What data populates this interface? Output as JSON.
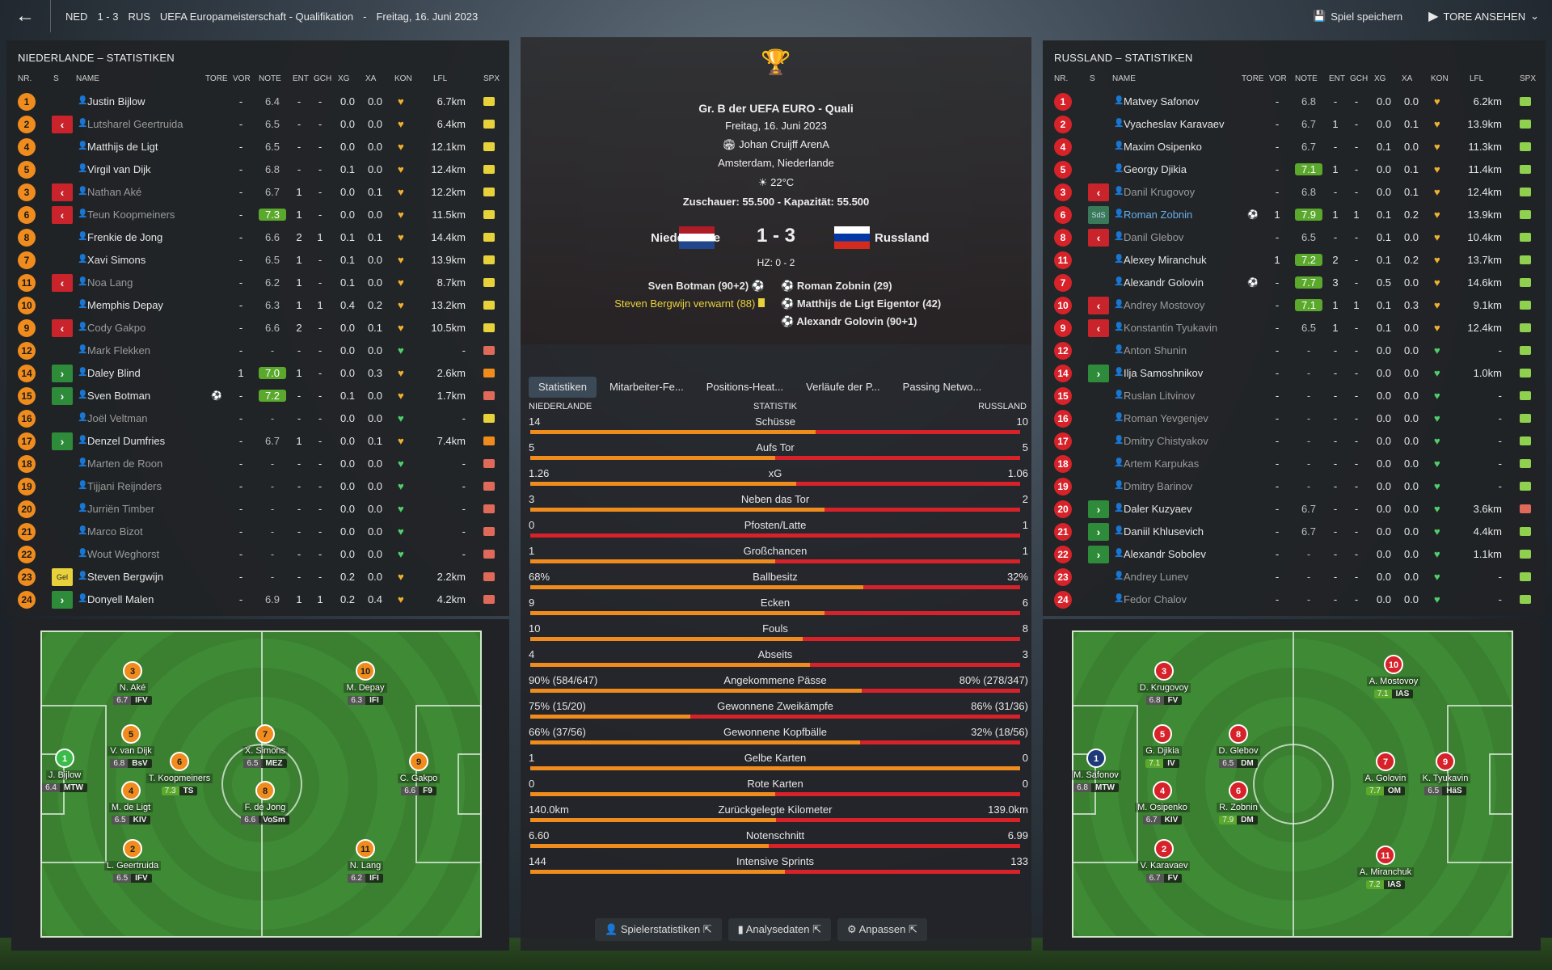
{
  "topbar": {
    "team_home": "NED",
    "score": "1 - 3",
    "team_away": "RUS",
    "competition": "UEFA Europameisterschaft - Qualifikation",
    "dash": "-",
    "date": "Freitag, 16. Juni 2023",
    "save": "Spiel speichern",
    "goals": "TORE ANSEHEN"
  },
  "left": {
    "title": "NIEDERLANDE – STATISTIKEN"
  },
  "right": {
    "title": "RUSSLAND – STATISTIKEN"
  },
  "headers": {
    "nr": "NR.",
    "s": "S",
    "name": "NAME",
    "tore": "TORE",
    "vor": "VOR",
    "note": "NOTE",
    "ent": "ENT",
    "gch": "GCH",
    "xg": "XG",
    "xa": "XA",
    "kon": "KON",
    "lfl": "LFL",
    "spx": "SPX"
  },
  "home_players": [
    {
      "nr": "1",
      "sub": "",
      "name": "Justin Bijlow",
      "tore": "-",
      "note": "6.4",
      "ent": "-",
      "gch": "-",
      "xg": "0.0",
      "xa": "0.0",
      "kon": "♥",
      "lfl": "6.7km",
      "spx": "y",
      "dim": false
    },
    {
      "nr": "2",
      "sub": "out",
      "name": "Lutsharel Geertruida",
      "tore": "-",
      "note": "6.5",
      "ent": "-",
      "gch": "-",
      "xg": "0.0",
      "xa": "0.0",
      "kon": "♥",
      "lfl": "6.4km",
      "spx": "y",
      "dim": true
    },
    {
      "nr": "4",
      "sub": "",
      "name": "Matthijs de Ligt",
      "tore": "-",
      "note": "6.5",
      "ent": "-",
      "gch": "-",
      "xg": "0.0",
      "xa": "0.0",
      "kon": "♥",
      "lfl": "12.1km",
      "spx": "y",
      "dim": false
    },
    {
      "nr": "5",
      "sub": "",
      "name": "Virgil van Dijk",
      "tore": "-",
      "note": "6.8",
      "ent": "-",
      "gch": "-",
      "xg": "0.1",
      "xa": "0.0",
      "kon": "♥",
      "lfl": "12.4km",
      "spx": "y",
      "dim": false
    },
    {
      "nr": "3",
      "sub": "out",
      "name": "Nathan Aké",
      "tore": "-",
      "note": "6.7",
      "ent": "1",
      "gch": "-",
      "xg": "0.0",
      "xa": "0.1",
      "kon": "♥",
      "lfl": "12.2km",
      "spx": "y",
      "dim": true
    },
    {
      "nr": "6",
      "sub": "out",
      "name": "Teun Koopmeiners",
      "tore": "-",
      "note": "7.3",
      "ent": "1",
      "gch": "-",
      "xg": "0.0",
      "xa": "0.0",
      "kon": "♥",
      "lfl": "11.5km",
      "spx": "y",
      "dim": true
    },
    {
      "nr": "8",
      "sub": "",
      "name": "Frenkie de Jong",
      "tore": "-",
      "note": "6.6",
      "ent": "2",
      "gch": "1",
      "xg": "0.1",
      "xa": "0.1",
      "kon": "♥",
      "lfl": "14.4km",
      "spx": "y",
      "dim": false
    },
    {
      "nr": "7",
      "sub": "",
      "name": "Xavi Simons",
      "tore": "-",
      "note": "6.5",
      "ent": "1",
      "gch": "-",
      "xg": "0.1",
      "xa": "0.0",
      "kon": "♥",
      "lfl": "13.9km",
      "spx": "y",
      "dim": false
    },
    {
      "nr": "11",
      "sub": "out",
      "name": "Noa Lang",
      "tore": "-",
      "note": "6.2",
      "ent": "1",
      "gch": "-",
      "xg": "0.1",
      "xa": "0.0",
      "kon": "♥",
      "lfl": "8.7km",
      "spx": "y",
      "dim": true
    },
    {
      "nr": "10",
      "sub": "",
      "name": "Memphis Depay",
      "tore": "-",
      "note": "6.3",
      "ent": "1",
      "gch": "1",
      "xg": "0.4",
      "xa": "0.2",
      "kon": "♥",
      "lfl": "13.2km",
      "spx": "y",
      "dim": false
    },
    {
      "nr": "9",
      "sub": "out",
      "name": "Cody Gakpo",
      "tore": "-",
      "note": "6.6",
      "ent": "2",
      "gch": "-",
      "xg": "0.0",
      "xa": "0.1",
      "kon": "♥",
      "lfl": "10.5km",
      "spx": "y",
      "dim": true
    },
    {
      "nr": "12",
      "sub": "",
      "name": "Mark Flekken",
      "tore": "-",
      "note": "-",
      "ent": "-",
      "gch": "-",
      "xg": "0.0",
      "xa": "0.0",
      "kon": "♥",
      "lfl": "-",
      "spx": "r",
      "dim": true
    },
    {
      "nr": "14",
      "sub": "in",
      "name": "Daley Blind",
      "tore": "1",
      "note": "7.0",
      "ent": "1",
      "gch": "-",
      "xg": "0.0",
      "xa": "0.3",
      "kon": "♥",
      "lfl": "2.6km",
      "spx": "o",
      "dim": false
    },
    {
      "nr": "15",
      "sub": "in",
      "name": "Sven Botman",
      "tore": "⚽",
      "note": "7.2",
      "ent": "-",
      "gch": "-",
      "xg": "0.1",
      "xa": "0.0",
      "kon": "♥",
      "lfl": "1.7km",
      "spx": "r",
      "dim": false
    },
    {
      "nr": "16",
      "sub": "",
      "name": "Joël Veltman",
      "tore": "-",
      "note": "-",
      "ent": "-",
      "gch": "-",
      "xg": "0.0",
      "xa": "0.0",
      "kon": "♥",
      "lfl": "-",
      "spx": "y",
      "dim": true
    },
    {
      "nr": "17",
      "sub": "in",
      "name": "Denzel Dumfries",
      "tore": "-",
      "note": "6.7",
      "ent": "1",
      "gch": "-",
      "xg": "0.0",
      "xa": "0.1",
      "kon": "♥",
      "lfl": "7.4km",
      "spx": "o",
      "dim": false
    },
    {
      "nr": "18",
      "sub": "",
      "name": "Marten de Roon",
      "tore": "-",
      "note": "-",
      "ent": "-",
      "gch": "-",
      "xg": "0.0",
      "xa": "0.0",
      "kon": "♥",
      "lfl": "-",
      "spx": "r",
      "dim": true
    },
    {
      "nr": "19",
      "sub": "",
      "name": "Tijjani Reijnders",
      "tore": "-",
      "note": "-",
      "ent": "-",
      "gch": "-",
      "xg": "0.0",
      "xa": "0.0",
      "kon": "♥",
      "lfl": "-",
      "spx": "r",
      "dim": true
    },
    {
      "nr": "20",
      "sub": "",
      "name": "Jurriën Timber",
      "tore": "-",
      "note": "-",
      "ent": "-",
      "gch": "-",
      "xg": "0.0",
      "xa": "0.0",
      "kon": "♥",
      "lfl": "-",
      "spx": "r",
      "dim": true
    },
    {
      "nr": "21",
      "sub": "",
      "name": "Marco Bizot",
      "tore": "-",
      "note": "-",
      "ent": "-",
      "gch": "-",
      "xg": "0.0",
      "xa": "0.0",
      "kon": "♥",
      "lfl": "-",
      "spx": "r",
      "dim": true
    },
    {
      "nr": "22",
      "sub": "",
      "name": "Wout Weghorst",
      "tore": "-",
      "note": "-",
      "ent": "-",
      "gch": "-",
      "xg": "0.0",
      "xa": "0.0",
      "kon": "♥",
      "lfl": "-",
      "spx": "r",
      "dim": true
    },
    {
      "nr": "23",
      "sub": "yel",
      "name": "Steven Bergwijn",
      "tore": "-",
      "note": "-",
      "ent": "-",
      "gch": "-",
      "xg": "0.2",
      "xa": "0.0",
      "kon": "♥",
      "lfl": "2.2km",
      "spx": "r",
      "dim": false
    },
    {
      "nr": "24",
      "sub": "in",
      "name": "Donyell Malen",
      "tore": "-",
      "note": "6.9",
      "ent": "1",
      "gch": "1",
      "xg": "0.2",
      "xa": "0.4",
      "kon": "♥",
      "lfl": "4.2km",
      "spx": "r",
      "dim": false
    }
  ],
  "away_players": [
    {
      "nr": "1",
      "sub": "",
      "name": "Matvey Safonov",
      "tore": "-",
      "note": "6.8",
      "ent": "-",
      "gch": "-",
      "xg": "0.0",
      "xa": "0.0",
      "kon": "♥",
      "lfl": "6.2km",
      "spx": "g",
      "dim": false
    },
    {
      "nr": "2",
      "sub": "",
      "name": "Vyacheslav Karavaev",
      "tore": "-",
      "note": "6.7",
      "ent": "1",
      "gch": "-",
      "xg": "0.0",
      "xa": "0.1",
      "kon": "♥",
      "lfl": "13.9km",
      "spx": "g",
      "dim": false
    },
    {
      "nr": "4",
      "sub": "",
      "name": "Maxim Osipenko",
      "tore": "-",
      "note": "6.7",
      "ent": "-",
      "gch": "-",
      "xg": "0.1",
      "xa": "0.0",
      "kon": "♥",
      "lfl": "11.3km",
      "spx": "g",
      "dim": false
    },
    {
      "nr": "5",
      "sub": "",
      "name": "Georgy Djikia",
      "tore": "-",
      "note": "7.1",
      "ent": "1",
      "gch": "-",
      "xg": "0.0",
      "xa": "0.1",
      "kon": "♥",
      "lfl": "11.4km",
      "spx": "g",
      "dim": false
    },
    {
      "nr": "3",
      "sub": "out",
      "name": "Danil Krugovoy",
      "tore": "-",
      "note": "6.8",
      "ent": "-",
      "gch": "-",
      "xg": "0.0",
      "xa": "0.1",
      "kon": "♥",
      "lfl": "12.4km",
      "spx": "g",
      "dim": true
    },
    {
      "nr": "6",
      "sub": "sds",
      "name": "Roman Zobnin",
      "tore": "⚽",
      "note": "7.9",
      "ent": "1",
      "gch": "1",
      "xg": "0.1",
      "xa": "0.2",
      "kon": "♥",
      "lfl": "13.9km",
      "spx": "g",
      "dim": false,
      "hl": true
    },
    {
      "nr": "8",
      "sub": "out",
      "name": "Danil Glebov",
      "tore": "-",
      "note": "6.5",
      "ent": "-",
      "gch": "-",
      "xg": "0.1",
      "xa": "0.0",
      "kon": "♥",
      "lfl": "10.4km",
      "spx": "g",
      "dim": true
    },
    {
      "nr": "11",
      "sub": "",
      "name": "Alexey Miranchuk",
      "tore": "1",
      "note": "7.2",
      "ent": "2",
      "gch": "-",
      "xg": "0.1",
      "xa": "0.2",
      "kon": "♥",
      "lfl": "13.7km",
      "spx": "g",
      "dim": false
    },
    {
      "nr": "7",
      "sub": "",
      "name": "Alexandr Golovin",
      "tore": "⚽",
      "note": "7.7",
      "ent": "3",
      "gch": "-",
      "xg": "0.5",
      "xa": "0.0",
      "kon": "♥",
      "lfl": "14.6km",
      "spx": "g",
      "dim": false
    },
    {
      "nr": "10",
      "sub": "out",
      "name": "Andrey Mostovoy",
      "tore": "-",
      "note": "7.1",
      "ent": "1",
      "gch": "1",
      "xg": "0.1",
      "xa": "0.3",
      "kon": "♥",
      "lfl": "9.1km",
      "spx": "g",
      "dim": true
    },
    {
      "nr": "9",
      "sub": "out",
      "name": "Konstantin Tyukavin",
      "tore": "-",
      "note": "6.5",
      "ent": "1",
      "gch": "-",
      "xg": "0.1",
      "xa": "0.0",
      "kon": "♥",
      "lfl": "12.4km",
      "spx": "g",
      "dim": true
    },
    {
      "nr": "12",
      "sub": "",
      "name": "Anton Shunin",
      "tore": "-",
      "note": "-",
      "ent": "-",
      "gch": "-",
      "xg": "0.0",
      "xa": "0.0",
      "kon": "♥",
      "lfl": "-",
      "spx": "g",
      "dim": true
    },
    {
      "nr": "14",
      "sub": "in",
      "name": "Ilja Samoshnikov",
      "tore": "-",
      "note": "-",
      "ent": "-",
      "gch": "-",
      "xg": "0.0",
      "xa": "0.0",
      "kon": "♥",
      "lfl": "1.0km",
      "spx": "g",
      "dim": false
    },
    {
      "nr": "15",
      "sub": "",
      "name": "Ruslan Litvinov",
      "tore": "-",
      "note": "-",
      "ent": "-",
      "gch": "-",
      "xg": "0.0",
      "xa": "0.0",
      "kon": "♥",
      "lfl": "-",
      "spx": "g",
      "dim": true
    },
    {
      "nr": "16",
      "sub": "",
      "name": "Roman Yevgenjev",
      "tore": "-",
      "note": "-",
      "ent": "-",
      "gch": "-",
      "xg": "0.0",
      "xa": "0.0",
      "kon": "♥",
      "lfl": "-",
      "spx": "g",
      "dim": true
    },
    {
      "nr": "17",
      "sub": "",
      "name": "Dmitry Chistyakov",
      "tore": "-",
      "note": "-",
      "ent": "-",
      "gch": "-",
      "xg": "0.0",
      "xa": "0.0",
      "kon": "♥",
      "lfl": "-",
      "spx": "g",
      "dim": true
    },
    {
      "nr": "18",
      "sub": "",
      "name": "Artem Karpukas",
      "tore": "-",
      "note": "-",
      "ent": "-",
      "gch": "-",
      "xg": "0.0",
      "xa": "0.0",
      "kon": "♥",
      "lfl": "-",
      "spx": "g",
      "dim": true
    },
    {
      "nr": "19",
      "sub": "",
      "name": "Dmitry Barinov",
      "tore": "-",
      "note": "-",
      "ent": "-",
      "gch": "-",
      "xg": "0.0",
      "xa": "0.0",
      "kon": "♥",
      "lfl": "-",
      "spx": "g",
      "dim": true
    },
    {
      "nr": "20",
      "sub": "in",
      "name": "Daler Kuzyaev",
      "tore": "-",
      "note": "6.7",
      "ent": "-",
      "gch": "-",
      "xg": "0.0",
      "xa": "0.0",
      "kon": "♥",
      "lfl": "3.6km",
      "spx": "r",
      "dim": false
    },
    {
      "nr": "21",
      "sub": "in",
      "name": "Daniil Khlusevich",
      "tore": "-",
      "note": "6.7",
      "ent": "-",
      "gch": "-",
      "xg": "0.0",
      "xa": "0.0",
      "kon": "♥",
      "lfl": "4.4km",
      "spx": "g",
      "dim": false
    },
    {
      "nr": "22",
      "sub": "in",
      "name": "Alexandr Sobolev",
      "tore": "-",
      "note": "-",
      "ent": "-",
      "gch": "-",
      "xg": "0.0",
      "xa": "0.0",
      "kon": "♥",
      "lfl": "1.1km",
      "spx": "g",
      "dim": false
    },
    {
      "nr": "23",
      "sub": "",
      "name": "Andrey Lunev",
      "tore": "-",
      "note": "-",
      "ent": "-",
      "gch": "-",
      "xg": "0.0",
      "xa": "0.0",
      "kon": "♥",
      "lfl": "-",
      "spx": "g",
      "dim": true
    },
    {
      "nr": "24",
      "sub": "",
      "name": "Fedor Chalov",
      "tore": "-",
      "note": "-",
      "ent": "-",
      "gch": "-",
      "xg": "0.0",
      "xa": "0.0",
      "kon": "♥",
      "lfl": "-",
      "spx": "g",
      "dim": true
    }
  ],
  "match": {
    "group": "Gr. B der UEFA EURO - Quali",
    "date": "Freitag, 16. Juni 2023",
    "stadium": "Johan Cruijff ArenA",
    "city": "Amsterdam, Niederlande",
    "temp": "22°C",
    "spectators": "Zuschauer: 55.500",
    "dash": "-",
    "capacity": "Kapazität: 55.500",
    "home": "Niederlande",
    "away": "Russland",
    "score": "1 - 3",
    "ht": "HZ: 0 - 2",
    "home_events": [
      "Sven Botman (90+2)",
      "Steven Bergwijn verwarnt (88)"
    ],
    "away_events": [
      "Roman Zobnin (29)",
      "Matthijs de Ligt Eigentor (42)",
      "Alexandr Golovin (90+1)"
    ]
  },
  "tabs": [
    "Statistiken",
    "Mitarbeiter-Fe...",
    "Positions-Heat...",
    "Verläufe der P...",
    "Passing Netwo..."
  ],
  "stats_header": {
    "home": "NIEDERLANDE",
    "mid": "STATISTIK",
    "away": "RUSSLAND"
  },
  "stats": [
    {
      "label": "Schüsse",
      "home": "14",
      "away": "10",
      "hshare": 0.583
    },
    {
      "label": "Aufs Tor",
      "home": "5",
      "away": "5",
      "hshare": 0.5
    },
    {
      "label": "xG",
      "home": "1.26",
      "away": "1.06",
      "hshare": 0.543
    },
    {
      "label": "Neben das Tor",
      "home": "3",
      "away": "2",
      "hshare": 0.6
    },
    {
      "label": "Pfosten/Latte",
      "home": "0",
      "away": "1",
      "hshare": 0.0
    },
    {
      "label": "Großchancen",
      "home": "1",
      "away": "1",
      "hshare": 0.5
    },
    {
      "label": "Ballbesitz",
      "home": "68%",
      "away": "32%",
      "hshare": 0.68
    },
    {
      "label": "Ecken",
      "home": "9",
      "away": "6",
      "hshare": 0.6
    },
    {
      "label": "Fouls",
      "home": "10",
      "away": "8",
      "hshare": 0.556
    },
    {
      "label": "Abseits",
      "home": "4",
      "away": "3",
      "hshare": 0.571
    },
    {
      "label": "Angekommene Pässe",
      "home": "90% (584/647)",
      "away": "80% (278/347)",
      "hshare": 0.677
    },
    {
      "label": "Gewonnene Zweikämpfe",
      "home": "75% (15/20)",
      "away": "86% (31/36)",
      "hshare": 0.326
    },
    {
      "label": "Gewonnene Kopfbälle",
      "home": "66% (37/56)",
      "away": "32% (18/56)",
      "hshare": 0.673
    },
    {
      "label": "Gelbe Karten",
      "home": "1",
      "away": "0",
      "hshare": 1.0
    },
    {
      "label": "Rote Karten",
      "home": "0",
      "away": "0",
      "hshare": 0.5
    },
    {
      "label": "Zurückgelegte Kilometer",
      "home": "140.0km",
      "away": "139.0km",
      "hshare": 0.502
    },
    {
      "label": "Notenschnitt",
      "home": "6.60",
      "away": "6.99",
      "hshare": 0.486
    },
    {
      "label": "Intensive Sprints",
      "home": "144",
      "away": "133",
      "hshare": 0.52
    }
  ],
  "bottom_buttons": [
    "Spielerstatistiken",
    "Analysedaten",
    "Anpassen"
  ],
  "home_lineup": [
    {
      "nr": "1",
      "name": "J. Bijlow",
      "rating": "6.4",
      "pos": "MTW",
      "c": "g",
      "gr": false
    },
    {
      "nr": "3",
      "name": "N. Aké",
      "rating": "6.7",
      "pos": "IFV",
      "c": "o",
      "gr": false
    },
    {
      "nr": "5",
      "name": "V. van Dijk",
      "rating": "6.8",
      "pos": "BsV",
      "c": "o",
      "gr": false
    },
    {
      "nr": "4",
      "name": "M. de Ligt",
      "rating": "6.5",
      "pos": "KIV",
      "c": "o",
      "gr": false
    },
    {
      "nr": "6",
      "name": "T. Koopmeiners",
      "rating": "7.3",
      "pos": "TS",
      "c": "o",
      "gr": true
    },
    {
      "nr": "2",
      "name": "L. Geertruida",
      "rating": "6.5",
      "pos": "IFV",
      "c": "o",
      "gr": false
    },
    {
      "nr": "7",
      "name": "X. Simons",
      "rating": "6.5",
      "pos": "MEZ",
      "c": "o",
      "gr": false
    },
    {
      "nr": "8",
      "name": "F. de Jong",
      "rating": "6.6",
      "pos": "VoSm",
      "c": "o",
      "gr": false
    },
    {
      "nr": "10",
      "name": "M. Depay",
      "rating": "6.3",
      "pos": "IFI",
      "c": "o",
      "gr": false
    },
    {
      "nr": "9",
      "name": "C. Gakpo",
      "rating": "6.6",
      "pos": "F9",
      "c": "o",
      "gr": false
    },
    {
      "nr": "11",
      "name": "N. Lang",
      "rating": "6.2",
      "pos": "IFI",
      "c": "o",
      "gr": false
    }
  ],
  "away_lineup": [
    {
      "nr": "1",
      "name": "M. Safonov",
      "rating": "6.8",
      "pos": "MTW",
      "c": "b",
      "gr": false
    },
    {
      "nr": "3",
      "name": "D. Krugovoy",
      "rating": "6.8",
      "pos": "FV",
      "c": "r",
      "gr": false
    },
    {
      "nr": "5",
      "name": "G. Djikia",
      "rating": "7.1",
      "pos": "IV",
      "c": "r",
      "gr": true
    },
    {
      "nr": "4",
      "name": "M. Osipenko",
      "rating": "6.7",
      "pos": "KIV",
      "c": "r",
      "gr": false
    },
    {
      "nr": "2",
      "name": "V. Karavaev",
      "rating": "6.7",
      "pos": "FV",
      "c": "r",
      "gr": false
    },
    {
      "nr": "8",
      "name": "D. Glebov",
      "rating": "6.5",
      "pos": "DM",
      "c": "r",
      "gr": false
    },
    {
      "nr": "6",
      "name": "R. Zobnin",
      "rating": "7.9",
      "pos": "DM",
      "c": "r",
      "gr": true
    },
    {
      "nr": "10",
      "name": "A. Mostovoy",
      "rating": "7.1",
      "pos": "IAS",
      "c": "r",
      "gr": true
    },
    {
      "nr": "7",
      "name": "A. Golovin",
      "rating": "7.7",
      "pos": "OM",
      "c": "r",
      "gr": true
    },
    {
      "nr": "9",
      "name": "K. Tyukavin",
      "rating": "6.5",
      "pos": "HäS",
      "c": "r",
      "gr": false
    },
    {
      "nr": "11",
      "name": "A. Miranchuk",
      "rating": "7.2",
      "pos": "IAS",
      "c": "r",
      "gr": true
    }
  ],
  "colors": {
    "home": "#f08c1e",
    "away": "#d7222a",
    "sub_in": "#2e8b3a",
    "rating_good": "#5aa82c"
  }
}
